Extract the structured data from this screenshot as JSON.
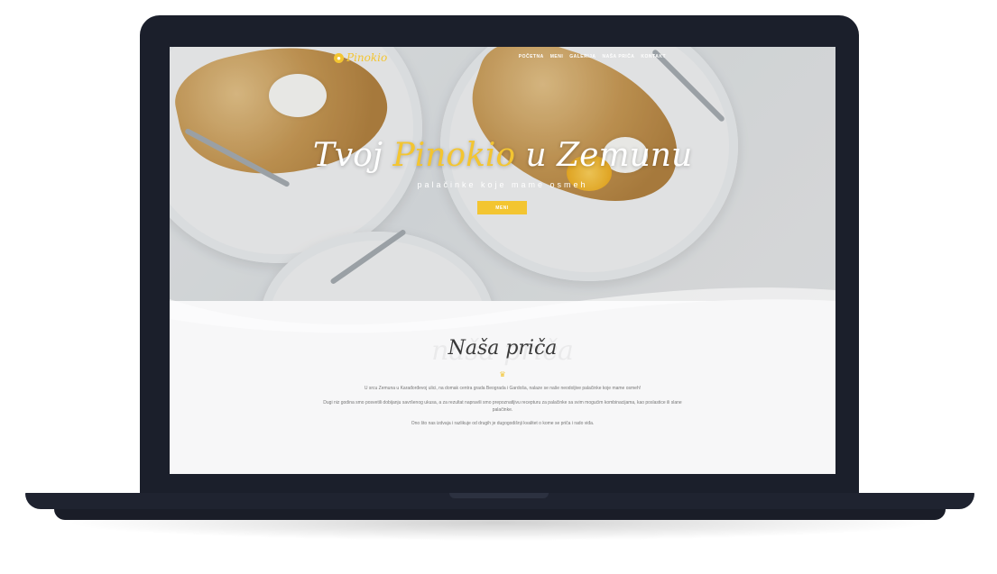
{
  "nav": {
    "logo_text": "Pinokio",
    "items": [
      "POČETNA",
      "MENI",
      "GALERIJA",
      "NAŠA PRIČA",
      "KONTAKT"
    ]
  },
  "hero": {
    "title_part1": "Tvoj ",
    "title_accent": "Pinokio",
    "title_part2": " u Zemunu",
    "subtitle": "palačinke koje mame osmeh",
    "button_label": "MENI"
  },
  "story": {
    "bg_word": "naša priča",
    "title": "Naša priča",
    "paragraphs": [
      "U srcu Zemuna u Karađorđevoj ulici, na domak centra grada Beograda i Gardoša, nalaze se naše neodoljive palačinke koje mame osmeh!",
      "Dugi niz godina smo posvetili dobijanju savršenog ukusa, a za rezultat napravili smo prepoznatljivu recepturu za palačinke sa svim mogućim kombinacijama, kao poslastice ili slane palačinke.",
      "Ono što nas izdvaja i razlikuje od drugih je dugogodišnji kvalitet o kome se priča i rado viđa."
    ]
  },
  "colors": {
    "accent": "#f3c531",
    "laptop": "#1b1f2b",
    "text": "#3a3a3a"
  }
}
